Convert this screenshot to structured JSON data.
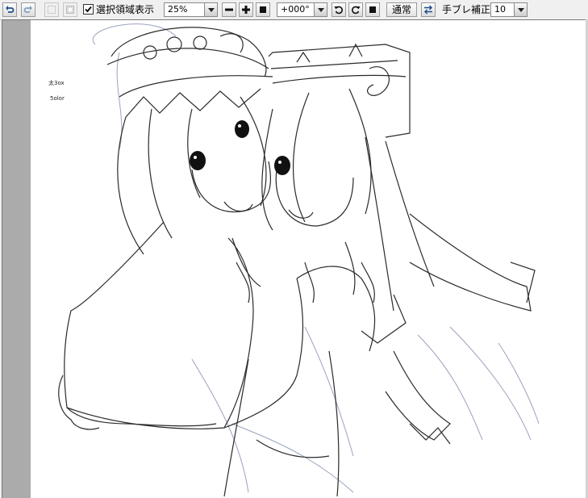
{
  "toolbar": {
    "undo_icon": "undo-icon",
    "redo_icon": "redo-icon",
    "show_selection_checked": true,
    "show_selection_label": "選択領域表示",
    "zoom_value": "25%",
    "rotation_value": "+000°",
    "blend_button_label": "通常",
    "stabilizer_label": "手ブレ補正",
    "stabilizer_value": "10"
  },
  "canvas": {
    "note_line1": "太3ox",
    "note_line2": "5olor"
  }
}
